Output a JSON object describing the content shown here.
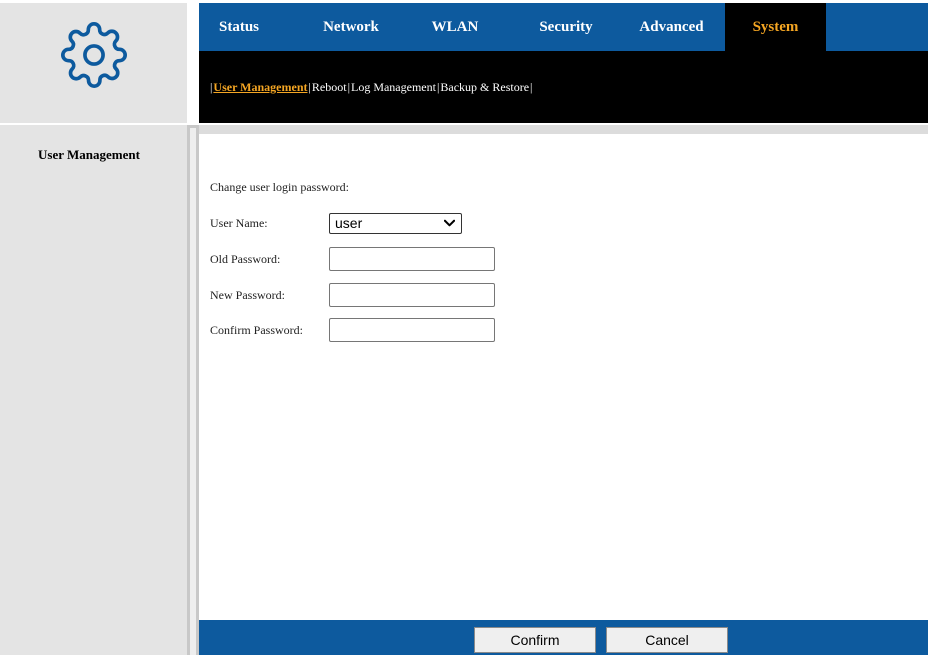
{
  "topnav": {
    "tabs": [
      {
        "label": "Status"
      },
      {
        "label": "Network"
      },
      {
        "label": "WLAN"
      },
      {
        "label": "Security"
      },
      {
        "label": "Advanced"
      },
      {
        "label": "System",
        "active": true
      }
    ]
  },
  "subnav": {
    "items": [
      {
        "label": "User Management",
        "active": true
      },
      {
        "label": "Reboot"
      },
      {
        "label": "Log Management"
      },
      {
        "label": "Backup & Restore"
      }
    ],
    "separator": "|"
  },
  "sidebar": {
    "items": [
      {
        "label": "User Management"
      }
    ]
  },
  "form": {
    "heading": "Change user login password:",
    "user_name_label": "User Name:",
    "user_name_value": "user",
    "old_password_label": "Old Password:",
    "new_password_label": "New Password:",
    "confirm_password_label": "Confirm Password:"
  },
  "footer": {
    "confirm_label": "Confirm",
    "cancel_label": "Cancel"
  },
  "colors": {
    "nav_blue": "#0d5a9e",
    "active_orange": "#f5a623",
    "sidebar_gray": "#e4e4e4"
  },
  "icons": {
    "logo": "gear-icon",
    "select_arrow": "chevron-down-icon"
  }
}
